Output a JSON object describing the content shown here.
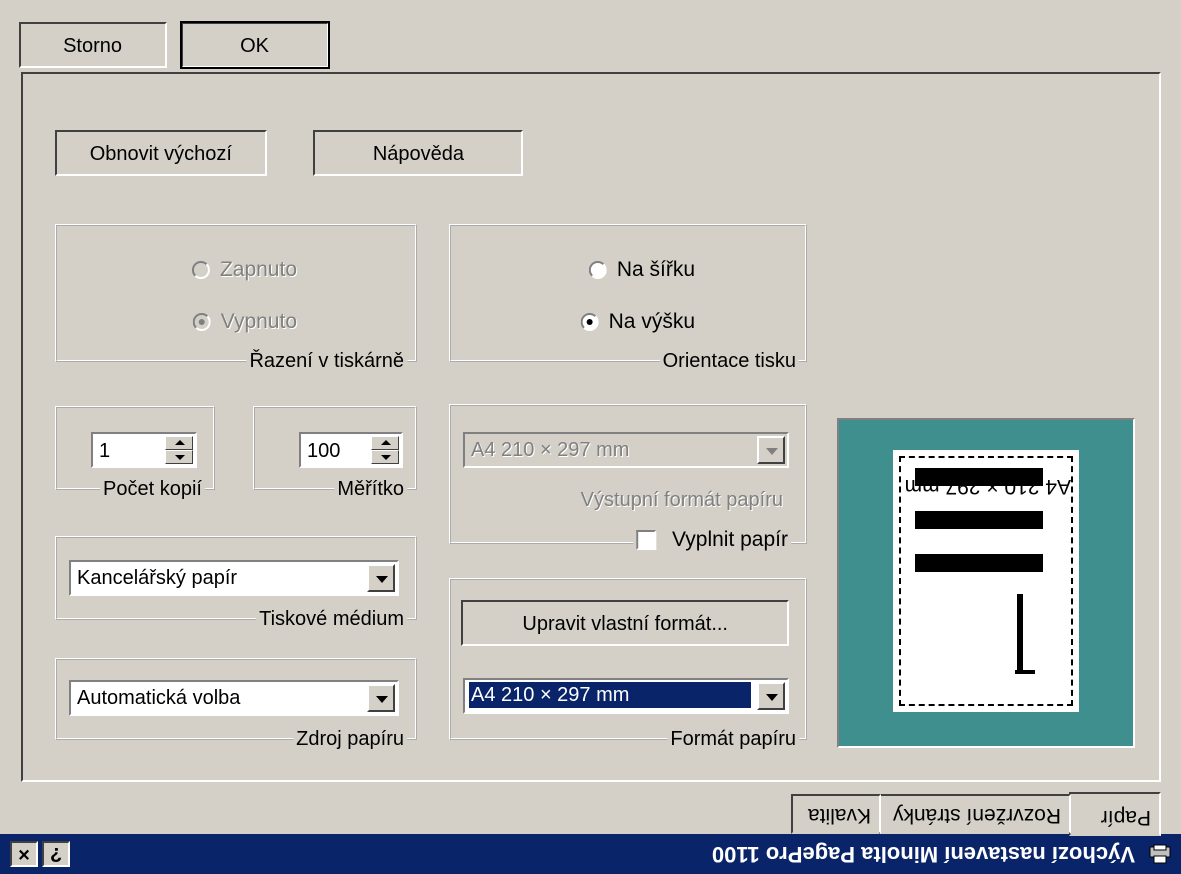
{
  "window": {
    "title": "Výchozí nastavení Minolta PagePro 1100",
    "help_glyph": "?",
    "close_glyph": "×"
  },
  "tabs": [
    "Papír",
    "Rozvržení stránky",
    "Kvalita"
  ],
  "preview": {
    "label": "A4 210 × 297 mm"
  },
  "paper_format": {
    "group_label": "Formát papíru",
    "selected": "A4 210 × 297 mm",
    "custom_button": "Upravit vlastní formát..."
  },
  "output_format": {
    "group_label": "Výstupní formát papíru",
    "fill_paper_label": "Vyplnit papír",
    "fill_paper_checked": false,
    "selected": "A4 210 × 297 mm"
  },
  "orientation": {
    "group_label": "Orientace tisku",
    "options": [
      "Na výšku",
      "Na šířku"
    ],
    "selected_index": 0
  },
  "collation": {
    "group_label": "Řazení v tiskárně",
    "options": [
      "Vypnuto",
      "Zapnuto"
    ],
    "selected_index": 0
  },
  "scale": {
    "group_label": "Měřítko",
    "value": "100"
  },
  "copies": {
    "group_label": "Počet kopií",
    "value": "1"
  },
  "media": {
    "group_label": "Tiskové médium",
    "selected": "Kancelářský papír"
  },
  "source": {
    "group_label": "Zdroj papíru",
    "selected": "Automatická volba"
  },
  "buttons": {
    "help": "Nápověda",
    "restore": "Obnovit výchozí",
    "ok": "OK",
    "cancel": "Storno"
  },
  "colors": {
    "titlebar": "#0a246a",
    "face": "#d4d0c8",
    "preview_bg": "#3f8f8f"
  }
}
